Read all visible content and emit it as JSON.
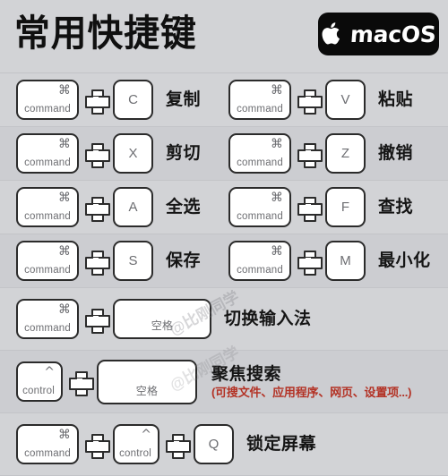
{
  "header": {
    "title": "常用快捷键",
    "badge": {
      "icon": "apple-logo-icon",
      "label": "macOS",
      "background": "#0a0a0a",
      "text_color": "#ffffff"
    }
  },
  "theme": {
    "page_background": "#d2d3d6",
    "row_alt_background": "#cccdd1",
    "key_fill": "#ffffff",
    "key_border": "#2b2b2b",
    "key_text": "#6d6e72",
    "label_color": "#151515",
    "accent_red": "#b33225"
  },
  "keys": {
    "command": {
      "glyph": "⌘",
      "name": "command"
    },
    "control": {
      "glyph": "^",
      "name": "control"
    },
    "space": {
      "name": "空格"
    }
  },
  "plus_symbol": "+",
  "watermark": "@比刚同学",
  "shortcuts": [
    {
      "row": 1,
      "left": {
        "keys": [
          "command",
          "C"
        ],
        "label": "复制"
      },
      "right": {
        "keys": [
          "command",
          "V"
        ],
        "label": "粘贴"
      }
    },
    {
      "row": 2,
      "left": {
        "keys": [
          "command",
          "X"
        ],
        "label": "剪切"
      },
      "right": {
        "keys": [
          "command",
          "Z"
        ],
        "label": "撤销"
      }
    },
    {
      "row": 3,
      "left": {
        "keys": [
          "command",
          "A"
        ],
        "label": "全选"
      },
      "right": {
        "keys": [
          "command",
          "F"
        ],
        "label": "查找"
      }
    },
    {
      "row": 4,
      "left": {
        "keys": [
          "command",
          "S"
        ],
        "label": "保存"
      },
      "right": {
        "keys": [
          "command",
          "M"
        ],
        "label": "最小化"
      }
    },
    {
      "row": 5,
      "full": {
        "keys": [
          "command",
          "空格"
        ],
        "label": "切换输入法"
      }
    },
    {
      "row": 6,
      "full": {
        "keys": [
          "control",
          "空格"
        ],
        "label": "聚焦搜索",
        "sublabel": "(可搜文件、应用程序、网页、设置项...)"
      }
    },
    {
      "row": 7,
      "full": {
        "keys": [
          "command",
          "control",
          "Q"
        ],
        "label": "锁定屏幕"
      }
    }
  ],
  "letters": {
    "c": "C",
    "v": "V",
    "x": "X",
    "z": "Z",
    "a": "A",
    "f": "F",
    "s": "S",
    "m": "M",
    "q": "Q"
  }
}
